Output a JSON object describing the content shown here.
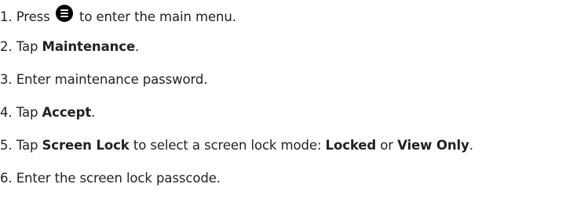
{
  "steps": [
    {
      "number": "1.",
      "before": "Press",
      "icon": "menu-button-icon",
      "after": "to enter the main menu."
    },
    {
      "number": "2.",
      "before": "Tap",
      "bold": "Maintenance",
      "after": "."
    },
    {
      "number": "3.",
      "text": "Enter maintenance password."
    },
    {
      "number": "4.",
      "before": "Tap",
      "bold": "Accept",
      "after": "."
    },
    {
      "number": "5.",
      "before": "Tap",
      "bold": "Screen Lock",
      "middle": "to select a screen lock mode:",
      "bold2": "Locked",
      "or": "or",
      "bold3": "View Only",
      "after": "."
    },
    {
      "number": "6.",
      "text": "Enter the screen lock passcode."
    }
  ]
}
